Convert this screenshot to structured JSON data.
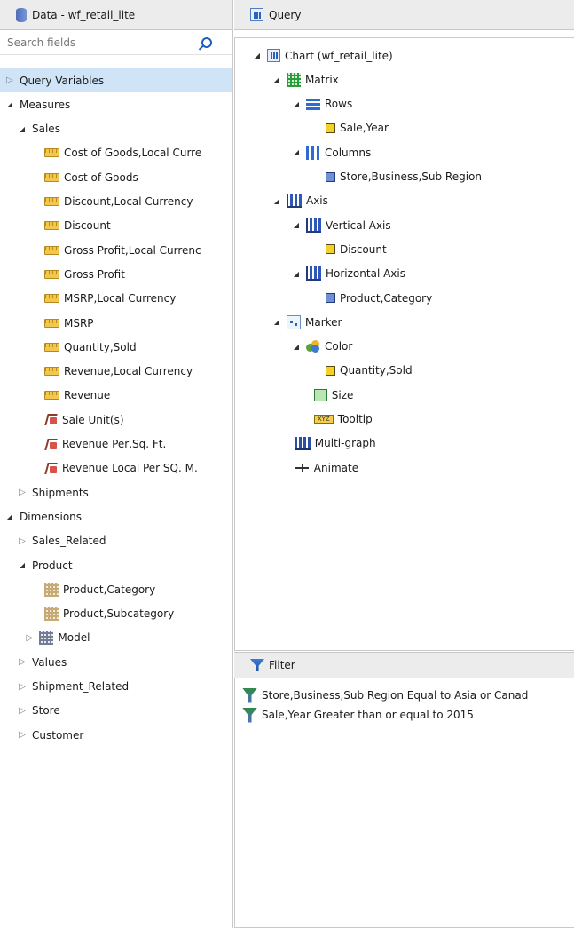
{
  "left_panel": {
    "title": "Data - wf_retail_lite",
    "search_placeholder": "Search fields",
    "tree": [
      {
        "label": "Query Variables",
        "level": 0,
        "toggle": "closed",
        "icon": "",
        "selected": true
      },
      {
        "label": "Measures",
        "level": 0,
        "toggle": "open",
        "icon": ""
      },
      {
        "label": "Sales",
        "level": 1,
        "toggle": "open",
        "icon": ""
      },
      {
        "label": "Cost of Goods,Local Curre",
        "level": 2,
        "toggle": "",
        "icon": "measure-icon"
      },
      {
        "label": "Cost of Goods",
        "level": 2,
        "toggle": "",
        "icon": "measure-icon"
      },
      {
        "label": "Discount,Local Currency",
        "level": 2,
        "toggle": "",
        "icon": "measure-icon"
      },
      {
        "label": "Discount",
        "level": 2,
        "toggle": "",
        "icon": "measure-icon"
      },
      {
        "label": "Gross Profit,Local Currenc",
        "level": 2,
        "toggle": "",
        "icon": "measure-icon"
      },
      {
        "label": "Gross Profit",
        "level": 2,
        "toggle": "",
        "icon": "measure-icon"
      },
      {
        "label": "MSRP,Local Currency",
        "level": 2,
        "toggle": "",
        "icon": "measure-icon"
      },
      {
        "label": "MSRP",
        "level": 2,
        "toggle": "",
        "icon": "measure-icon"
      },
      {
        "label": "Quantity,Sold",
        "level": 2,
        "toggle": "",
        "icon": "measure-icon"
      },
      {
        "label": "Revenue,Local Currency",
        "level": 2,
        "toggle": "",
        "icon": "measure-icon"
      },
      {
        "label": "Revenue",
        "level": 2,
        "toggle": "",
        "icon": "measure-icon"
      },
      {
        "label": "Sale Unit(s)",
        "level": 2,
        "toggle": "",
        "icon": "calculated-field-icon"
      },
      {
        "label": "Revenue Per,Sq. Ft.",
        "level": 2,
        "toggle": "",
        "icon": "calculated-field-icon"
      },
      {
        "label": "Revenue Local Per SQ. M.",
        "level": 2,
        "toggle": "",
        "icon": "calculated-field-icon"
      },
      {
        "label": "Shipments",
        "level": 1,
        "toggle": "closed",
        "icon": ""
      },
      {
        "label": "Dimensions",
        "level": 0,
        "toggle": "open",
        "icon": ""
      },
      {
        "label": "Sales_Related",
        "level": 1,
        "toggle": "closed",
        "icon": ""
      },
      {
        "label": "Product",
        "level": 1,
        "toggle": "open",
        "icon": ""
      },
      {
        "label": "Product,Category",
        "level": 2,
        "toggle": "",
        "icon": "dimension-icon"
      },
      {
        "label": "Product,Subcategory",
        "level": 2,
        "toggle": "",
        "icon": "dimension-icon"
      },
      {
        "label": "Model",
        "level": 1.6,
        "toggle": "closed",
        "icon": "hierarchy-icon"
      },
      {
        "label": "Values",
        "level": 1,
        "toggle": "closed",
        "icon": ""
      },
      {
        "label": "Shipment_Related",
        "level": 1,
        "toggle": "closed",
        "icon": ""
      },
      {
        "label": "Store",
        "level": 1,
        "toggle": "closed",
        "icon": ""
      },
      {
        "label": "Customer",
        "level": 1,
        "toggle": "closed",
        "icon": ""
      }
    ]
  },
  "query_panel": {
    "title": "Query",
    "tree": [
      {
        "label": "Chart (wf_retail_lite)",
        "level": 0,
        "toggle": "open",
        "icon": "chart-icon"
      },
      {
        "label": "Matrix",
        "level": 1,
        "toggle": "open",
        "icon": "matrix-icon"
      },
      {
        "label": "Rows",
        "level": 2,
        "toggle": "open",
        "icon": "rows-icon"
      },
      {
        "label": "Sale,Year",
        "level": 3,
        "toggle": "",
        "icon": "field-yellow-icon"
      },
      {
        "label": "Columns",
        "level": 2,
        "toggle": "open",
        "icon": "columns-icon"
      },
      {
        "label": "Store,Business,Sub Region",
        "level": 3,
        "toggle": "",
        "icon": "field-blue-icon"
      },
      {
        "label": "Axis",
        "level": 1,
        "toggle": "open",
        "icon": "axis-icon"
      },
      {
        "label": "Vertical Axis",
        "level": 2,
        "toggle": "open",
        "icon": "axis-icon"
      },
      {
        "label": "Discount",
        "level": 3,
        "toggle": "",
        "icon": "field-yellow-icon"
      },
      {
        "label": "Horizontal Axis",
        "level": 2,
        "toggle": "open",
        "icon": "axis-icon"
      },
      {
        "label": "Product,Category",
        "level": 3,
        "toggle": "",
        "icon": "field-blue-icon"
      },
      {
        "label": "Marker",
        "level": 1,
        "toggle": "open",
        "icon": "marker-icon"
      },
      {
        "label": "Color",
        "level": 2,
        "toggle": "open",
        "icon": "color-icon"
      },
      {
        "label": "Quantity,Sold",
        "level": 3,
        "toggle": "",
        "icon": "field-yellow-icon"
      },
      {
        "label": "Size",
        "level": 2.4,
        "toggle": "",
        "icon": "size-icon"
      },
      {
        "label": "Tooltip",
        "level": 2.4,
        "toggle": "",
        "icon": "tooltip-icon"
      },
      {
        "label": "Multi-graph",
        "level": 1.4,
        "toggle": "",
        "icon": "multigraph-icon"
      },
      {
        "label": "Animate",
        "level": 1.4,
        "toggle": "",
        "icon": "animate-icon"
      }
    ]
  },
  "filter_panel": {
    "title": "Filter",
    "items": [
      "Store,Business,Sub Region Equal to Asia or Canad",
      "Sale,Year Greater than or equal to 2015"
    ]
  },
  "icons": {
    "tooltip_text": "XYZ"
  }
}
